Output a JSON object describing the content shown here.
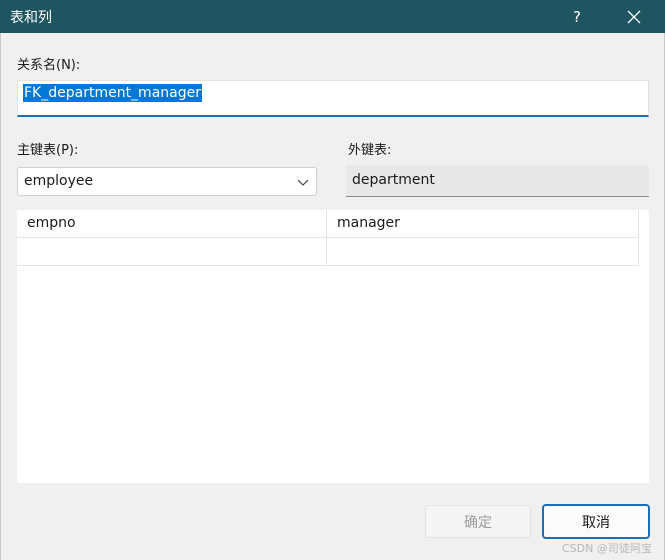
{
  "window": {
    "title": "表和列",
    "help_glyph": "?"
  },
  "relationship_name": {
    "label": "关系名(N):",
    "value": "FK_department_manager"
  },
  "primary_table": {
    "label": "主键表(P):",
    "selected": "employee"
  },
  "foreign_table": {
    "label": "外键表:",
    "value": "department"
  },
  "columns_grid": {
    "rows": [
      {
        "primary_column": "empno",
        "foreign_column": "manager"
      },
      {
        "primary_column": "",
        "foreign_column": ""
      }
    ]
  },
  "buttons": {
    "ok": "确定",
    "cancel": "取消"
  },
  "watermark": "CSDN @司徒阿宝",
  "colors": {
    "titlebar": "#1f5560",
    "accent": "#0078d7",
    "body": "#f0f0f0"
  },
  "icons": {
    "close": "close-icon",
    "dropdown": "chevron-down-icon"
  }
}
